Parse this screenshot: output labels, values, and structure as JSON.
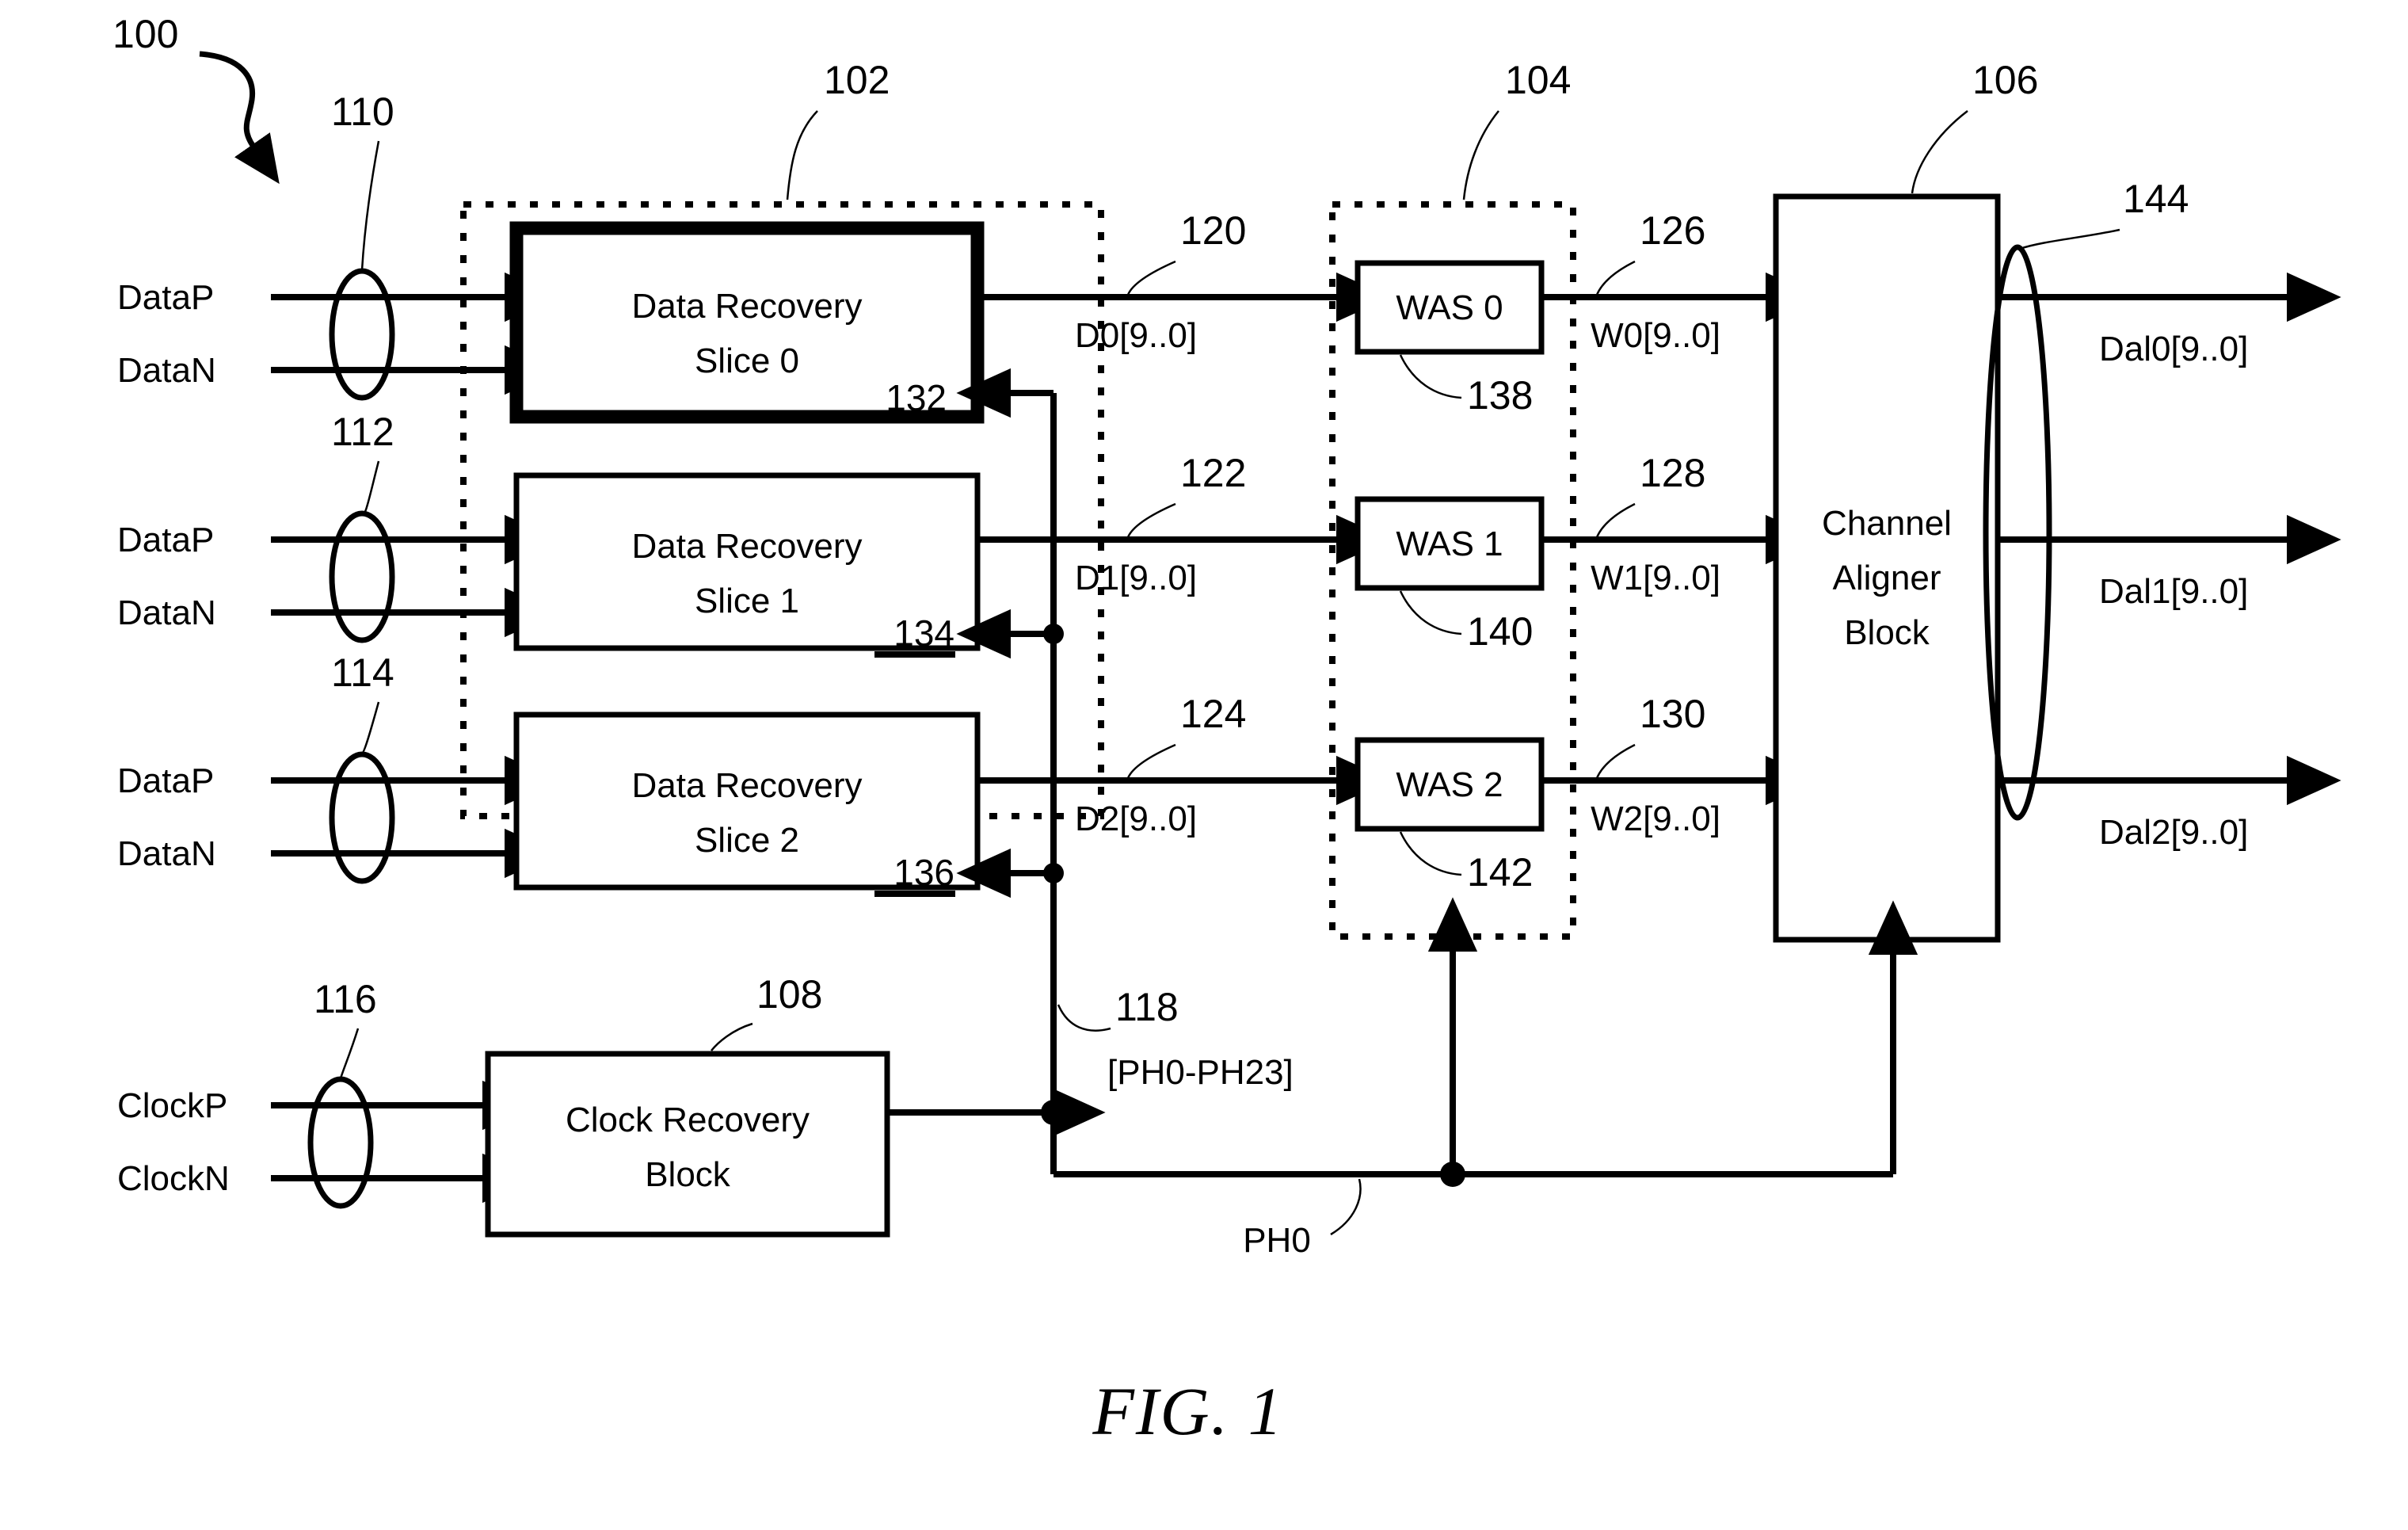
{
  "figure": {
    "caption": "FIG. 1",
    "system_ref": "100"
  },
  "groups": [
    {
      "ref": "102",
      "name": "data-recovery-group"
    },
    {
      "ref": "104",
      "name": "word-alignment-group"
    }
  ],
  "inputs": [
    {
      "ref": "110",
      "p_label": "DataP",
      "n_label": "DataN"
    },
    {
      "ref": "112",
      "p_label": "DataP",
      "n_label": "DataN"
    },
    {
      "ref": "114",
      "p_label": "DataP",
      "n_label": "DataN"
    },
    {
      "ref": "116",
      "p_label": "ClockP",
      "n_label": "ClockN"
    }
  ],
  "blocks": [
    {
      "ref": "132",
      "title_line1": "Data Recovery",
      "title_line2": "Slice 0",
      "emphasis": "bold"
    },
    {
      "ref": "134",
      "title_line1": "Data Recovery",
      "title_line2": "Slice 1",
      "emphasis": "normal"
    },
    {
      "ref": "136",
      "title_line1": "Data Recovery",
      "title_line2": "Slice 2",
      "emphasis": "normal"
    },
    {
      "ref": "138",
      "title_line1": "WAS 0",
      "title_line2": "",
      "emphasis": "normal"
    },
    {
      "ref": "140",
      "title_line1": "WAS 1",
      "title_line2": "",
      "emphasis": "normal"
    },
    {
      "ref": "142",
      "title_line1": "WAS 2",
      "title_line2": "",
      "emphasis": "normal"
    },
    {
      "ref": "106",
      "title_line1": "Channel",
      "title_line2": "Aligner",
      "title_line3": "Block",
      "emphasis": "normal"
    },
    {
      "ref": "108",
      "title_line1": "Clock Recovery",
      "title_line2": "Block",
      "emphasis": "normal"
    }
  ],
  "signals": [
    {
      "ref": "120",
      "label": "D0[9..0]"
    },
    {
      "ref": "122",
      "label": "D1[9..0]"
    },
    {
      "ref": "124",
      "label": "D2[9..0]"
    },
    {
      "ref": "126",
      "label": "W0[9..0]"
    },
    {
      "ref": "128",
      "label": "W1[9..0]"
    },
    {
      "ref": "130",
      "label": "W2[9..0]"
    },
    {
      "ref": "118",
      "label": "[PH0-PH23]"
    },
    {
      "ref": "144",
      "label": ""
    }
  ],
  "clock_signal": {
    "label": "PH0"
  },
  "outputs": [
    {
      "label": "Dal0[9..0]"
    },
    {
      "label": "Dal1[9..0]"
    },
    {
      "label": "Dal2[9..0]"
    }
  ],
  "colors": {
    "ink": "#000000",
    "paper": "#ffffff"
  }
}
